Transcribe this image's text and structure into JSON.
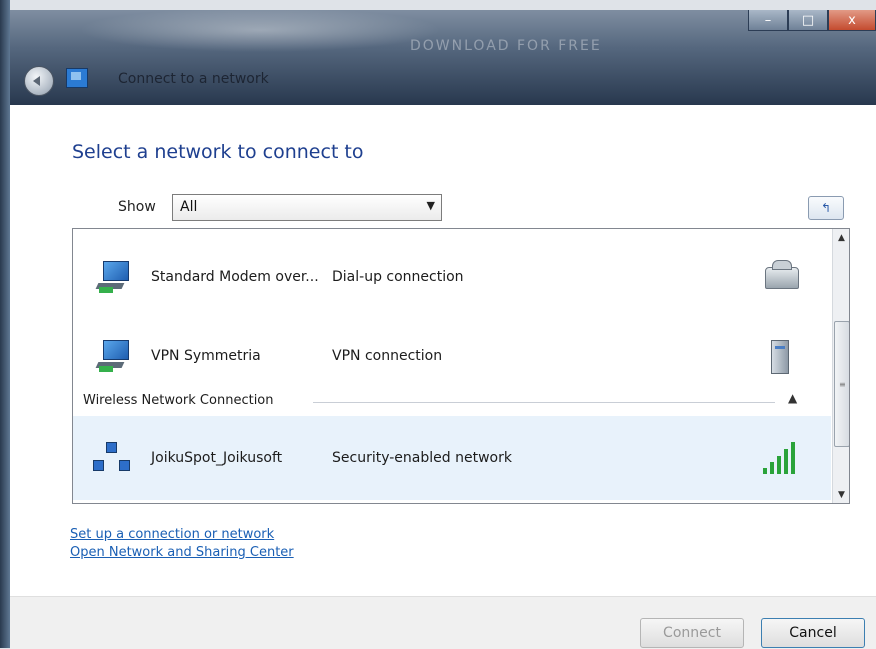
{
  "titlebar": {
    "title": "Connect to a network",
    "watermark": "DOWNLOAD FOR FREE",
    "controls": {
      "minimize": "–",
      "maximize": "□",
      "close": "x"
    }
  },
  "main": {
    "heading": "Select a network to connect to",
    "show_label": "Show",
    "show_value": "All",
    "refresh_icon_label": "↰"
  },
  "network_list": {
    "items": [
      {
        "name": "Standard Modem over...",
        "type": "Dial-up connection",
        "icon": "modem-icon"
      },
      {
        "name": "VPN Symmetria",
        "type": "VPN connection",
        "icon": "vpn-server-icon"
      }
    ],
    "group": {
      "label": "Wireless Network Connection",
      "collapse_icon": "chevron-up-icon"
    },
    "wireless": [
      {
        "name": "JoikuSpot_Joikusoft",
        "type": "Security-enabled network",
        "signal_bars": 5,
        "signal_color": "#2aa33a"
      }
    ]
  },
  "links": {
    "setup": "Set up a connection or network",
    "sharing_center": "Open Network and Sharing Center"
  },
  "footer": {
    "connect_label": "Connect",
    "cancel_label": "Cancel"
  },
  "colors": {
    "heading": "#1e3f8f",
    "link": "#1a5fb4",
    "selected_row": "#e8f2fb"
  }
}
